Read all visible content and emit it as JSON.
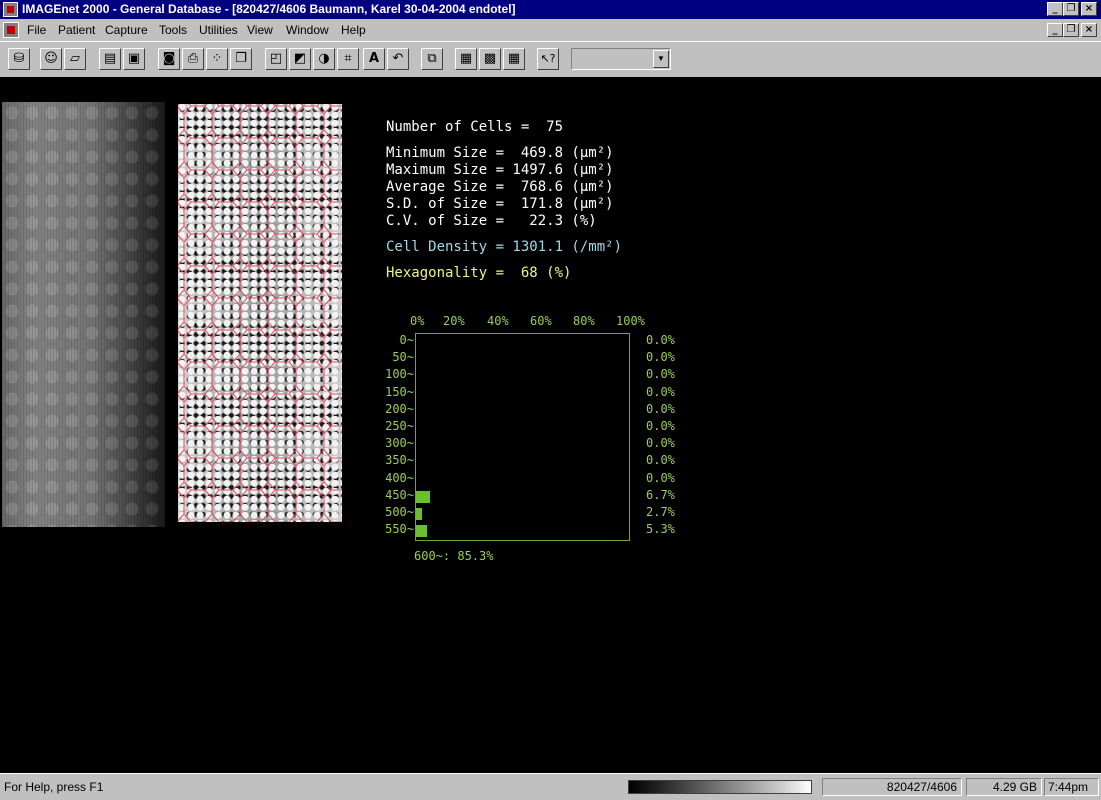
{
  "window": {
    "title": "IMAGEnet 2000 - General Database - [820427/4606 Baumann, Karel 30-04-2004 endotel]",
    "minimize": "_",
    "restore": "❐",
    "close": "×"
  },
  "menu": [
    "File",
    "Patient",
    "Capture",
    "Tools",
    "Utilities",
    "View",
    "Window",
    "Help"
  ],
  "toolbar": {
    "buttons": [
      {
        "icon": "database-icon",
        "glyph": "⛁"
      },
      {
        "icon": "patient-icon",
        "glyph": "☺"
      },
      {
        "icon": "open-folder-icon",
        "glyph": "▱"
      },
      {
        "icon": "document-icon",
        "glyph": "▤"
      },
      {
        "icon": "save-icon",
        "glyph": "▣"
      },
      {
        "icon": "camera-icon",
        "glyph": "◙"
      },
      {
        "icon": "print-icon",
        "glyph": "⎙"
      },
      {
        "icon": "grid-points-icon",
        "glyph": "⁘"
      },
      {
        "icon": "copy-icon",
        "glyph": "❐"
      },
      {
        "icon": "overlay-icon",
        "glyph": "◰"
      },
      {
        "icon": "contrast-icon",
        "glyph": "◩"
      },
      {
        "icon": "half-circle-icon",
        "glyph": "◑"
      },
      {
        "icon": "crop-icon",
        "glyph": "⌗"
      },
      {
        "icon": "text-icon",
        "glyph": "A"
      },
      {
        "icon": "undo-icon",
        "glyph": "↶"
      },
      {
        "icon": "windows-icon",
        "glyph": "⧉"
      },
      {
        "icon": "layout-2x2-icon",
        "glyph": "▦"
      },
      {
        "icon": "layout-3x3-icon",
        "glyph": "▩"
      },
      {
        "icon": "layout-4x4-icon",
        "glyph": "▦"
      },
      {
        "icon": "context-help-icon",
        "glyph": "↖?"
      }
    ],
    "combo_value": ""
  },
  "stats": {
    "number_of_cells": "Number of Cells =  75",
    "minimum_size": "Minimum Size =  469.8 (μm²)",
    "maximum_size": "Maximum Size = 1497.6 (μm²)",
    "average_size": "Average Size =  768.6 (μm²)",
    "sd_size": "S.D. of Size =  171.8 (μm²)",
    "cv_size": "C.V. of Size =   22.3 (%)",
    "cell_density": "Cell Density = 1301.1 (/mm²)",
    "hexagonality": "Hexagonality =  68 (%)"
  },
  "histogram": {
    "percent_axis": [
      "0%",
      "20%",
      "40%",
      "60%",
      "80%",
      "100%"
    ],
    "bins": [
      {
        "label": "0~",
        "pct_text": "0.0%",
        "value": 0.0
      },
      {
        "label": "50~",
        "pct_text": "0.0%",
        "value": 0.0
      },
      {
        "label": "100~",
        "pct_text": "0.0%",
        "value": 0.0
      },
      {
        "label": "150~",
        "pct_text": "0.0%",
        "value": 0.0
      },
      {
        "label": "200~",
        "pct_text": "0.0%",
        "value": 0.0
      },
      {
        "label": "250~",
        "pct_text": "0.0%",
        "value": 0.0
      },
      {
        "label": "300~",
        "pct_text": "0.0%",
        "value": 0.0
      },
      {
        "label": "350~",
        "pct_text": "0.0%",
        "value": 0.0
      },
      {
        "label": "400~",
        "pct_text": "0.0%",
        "value": 0.0
      },
      {
        "label": "450~",
        "pct_text": "6.7%",
        "value": 6.7
      },
      {
        "label": "500~",
        "pct_text": "2.7%",
        "value": 2.7
      },
      {
        "label": "550~",
        "pct_text": "5.3%",
        "value": 5.3
      }
    ],
    "footer": "600~: 85.3%"
  },
  "statusbar": {
    "help": "For Help, press F1",
    "patient_id": "820427/4606",
    "disk": "4.29 GB",
    "time": "7:44pm"
  }
}
